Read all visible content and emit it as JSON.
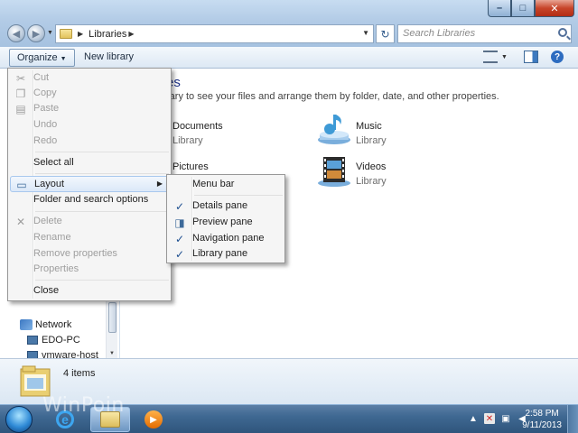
{
  "address": {
    "breadcrumb": "Libraries"
  },
  "search": {
    "placeholder": "Search Libraries"
  },
  "toolbar": {
    "organize_label": "Organize",
    "new_library_label": "New library"
  },
  "navpane": {
    "items": [
      "Network",
      "EDO-PC",
      "vmware-host"
    ]
  },
  "content": {
    "heading": "es",
    "description": "rary to see your files and arrange them by folder, date, and other properties.",
    "libraries": [
      {
        "name": "Documents",
        "type": "Library"
      },
      {
        "name": "Music",
        "type": "Library"
      },
      {
        "name": "Pictures",
        "type": "Library"
      },
      {
        "name": "Videos",
        "type": "Library"
      }
    ]
  },
  "organize_menu": {
    "cut": "Cut",
    "copy": "Copy",
    "paste": "Paste",
    "undo": "Undo",
    "redo": "Redo",
    "select_all": "Select all",
    "layout": "Layout",
    "folder_options": "Folder and search options",
    "delete": "Delete",
    "rename": "Rename",
    "remove_properties": "Remove properties",
    "properties": "Properties",
    "close": "Close"
  },
  "layout_submenu": {
    "menu_bar": "Menu bar",
    "details_pane": "Details pane",
    "preview_pane": "Preview pane",
    "navigation_pane": "Navigation pane",
    "library_pane": "Library pane",
    "details_checked": true,
    "preview_checked": false,
    "navigation_checked": true,
    "library_checked": true
  },
  "status": {
    "items_count": "4 items"
  },
  "taskbar": {
    "time": "2:58 PM",
    "date": "9/11/2013"
  },
  "watermark": "WinPoin",
  "colors": {
    "accent": "#1e3287",
    "taskbar": "#3f6892",
    "menu_highlight": "#dbe8f8"
  }
}
